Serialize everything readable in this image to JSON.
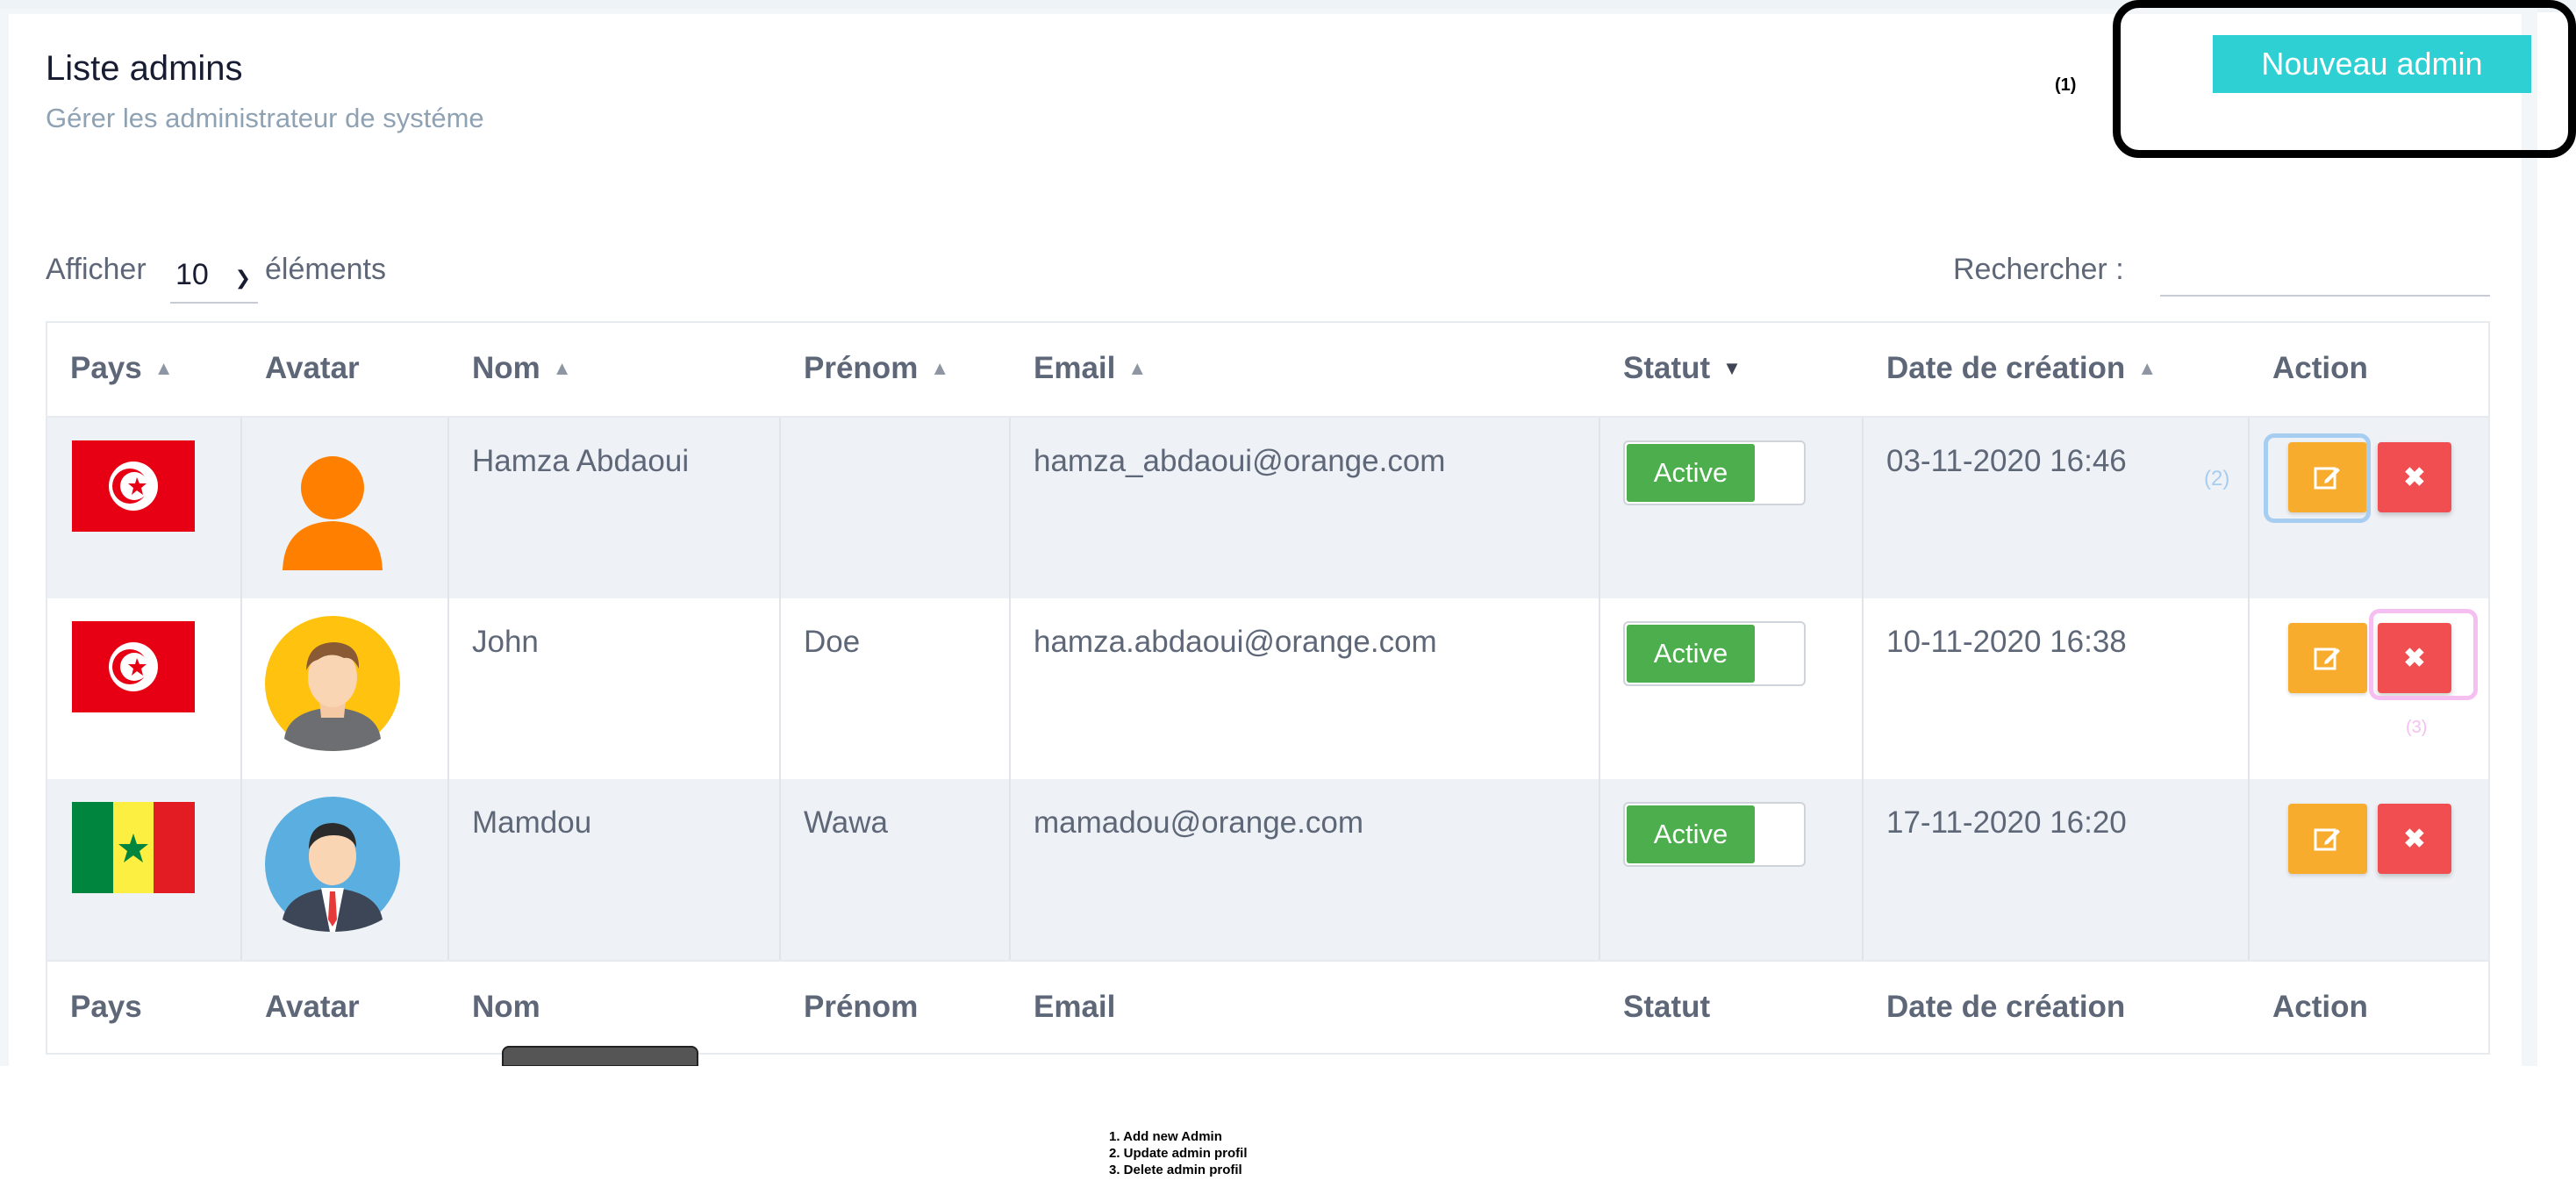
{
  "header": {
    "title": "Liste admins",
    "subtitle": "Gérer les administrateur de systéme",
    "new_admin_label": "Nouveau admin"
  },
  "annotations": {
    "box1_label": "(1)",
    "box2_label": "(2)",
    "box3_label": "(3)",
    "notes": [
      "1. Add new Admin",
      "2. Update admin profil",
      "3. Delete admin profil"
    ],
    "box1_color": "#000000",
    "box2_color": "#a7cdf1",
    "box3_color": "#f5bff1"
  },
  "controls": {
    "show_label": "Afficher",
    "show_value": "10",
    "elements_label": "éléments",
    "search_label": "Rechercher :",
    "search_value": ""
  },
  "table": {
    "columns": [
      "Pays",
      "Avatar",
      "Nom",
      "Prénom",
      "Email",
      "Statut",
      "Date de création",
      "Action"
    ],
    "rows": [
      {
        "country_flag": "flag-tunisia-icon",
        "avatar": "orange-user-silhouette",
        "nom": "Hamza Abdaoui",
        "prenom": "",
        "email": "hamza_abdaoui@orange.com",
        "statut": "Active",
        "date": "03-11-2020 16:46"
      },
      {
        "country_flag": "flag-tunisia-icon",
        "avatar": "man-hoodie-yellow-bg",
        "nom": "John",
        "prenom": "Doe",
        "email": "hamza.abdaoui@orange.com",
        "statut": "Active",
        "date": "10-11-2020 16:38"
      },
      {
        "country_flag": "flag-senegal-icon",
        "avatar": "man-suit-blue-bg",
        "nom": "Mamdou",
        "prenom": "Wawa",
        "email": "mamadou@orange.com",
        "statut": "Active",
        "date": "17-11-2020 16:20"
      }
    ]
  },
  "colors": {
    "primary": "#2ed0d3",
    "edit": "#f8ac2d",
    "delete": "#f04e51",
    "active": "#4cae4c"
  }
}
